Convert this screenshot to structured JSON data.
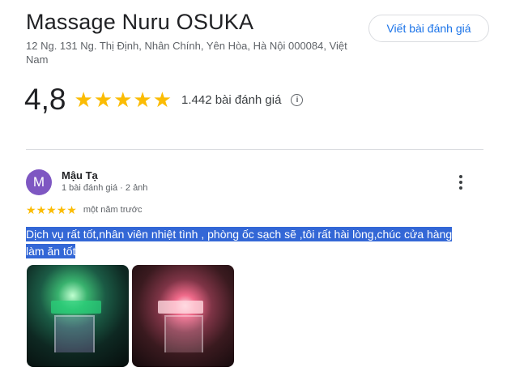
{
  "place": {
    "title": "Massage Nuru OSUKA",
    "address": "12 Ng. 131 Ng. Thị Định, Nhân Chính, Yên Hòa, Hà Nội 000084, Việt Nam",
    "write_review_label": "Viết bài đánh giá"
  },
  "rating": {
    "value": "4,8",
    "stars": 5,
    "review_count": "1.442 bài đánh giá",
    "info_icon_glyph": "i",
    "star_color": "#fbbc04"
  },
  "review": {
    "avatar_letter": "M",
    "avatar_color": "#7e57c2",
    "author": "Mậu Tạ",
    "meta": "1 bài đánh giá · 2 ảnh",
    "stars": 5,
    "date": "một năm trước",
    "text": "Dịch vụ rất tốt,nhân viên nhiệt tình , phòng ốc sạch sẽ ,tôi rất hài lòng,chúc cửa hàng làm ăn tốt",
    "text_selected": true,
    "selection_color": "#3367d6",
    "photos": [
      {
        "description_icon": "storefront-photo-green"
      },
      {
        "description_icon": "storefront-photo-pink"
      }
    ]
  },
  "icons": {
    "star": "★",
    "more": "more-vert-icon",
    "info": "info-icon"
  }
}
